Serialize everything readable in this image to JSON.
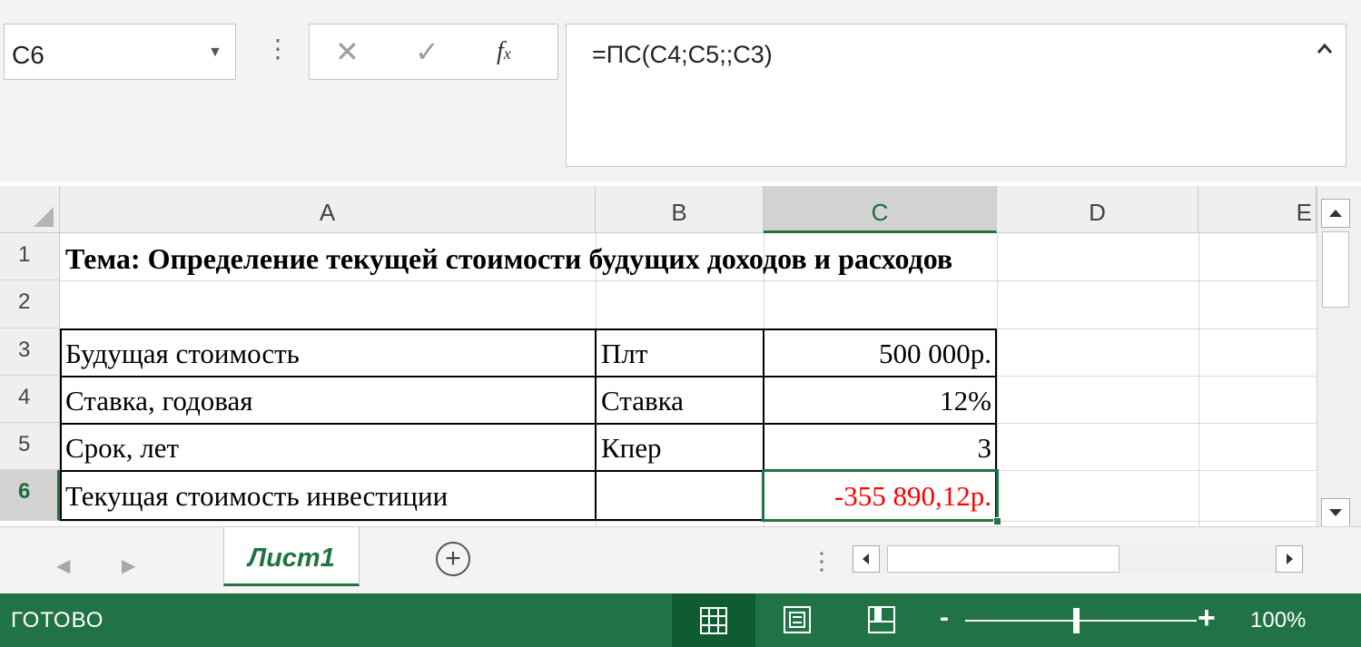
{
  "formula_bar": {
    "name_box": "C6",
    "formula": "=ПС(C4;C5;;C3)"
  },
  "columns": [
    "A",
    "B",
    "C",
    "D",
    "E"
  ],
  "rows": [
    "1",
    "2",
    "3",
    "4",
    "5",
    "6"
  ],
  "cells": {
    "A1": "Тема: Определение текущей стоимости будущих доходов и расходов",
    "A3": "Будущая стоимость",
    "B3": "Плт",
    "C3": "500 000р.",
    "A4": "Ставка, годовая",
    "B4": "Ставка",
    "C4": "12%",
    "A5": "Срок, лет",
    "B5": "Кпер",
    "C5": "3",
    "A6": "Текущая стоимость инвестиции",
    "B6": "",
    "C6": "-355 890,12р."
  },
  "selected_cell": "C6",
  "negative_color": "#ff0000",
  "accent_color": "#217346",
  "sheet_tabs": [
    "Лист1"
  ],
  "status": {
    "ready": "ГОТОВО",
    "zoom": "100%",
    "zoom_level": 1.0
  },
  "icons": {
    "cancel": "close-icon",
    "enter": "checkmark-icon",
    "function": "fx-icon",
    "collapse": "chevron-up-icon",
    "add_sheet": "plus-circle-icon"
  }
}
